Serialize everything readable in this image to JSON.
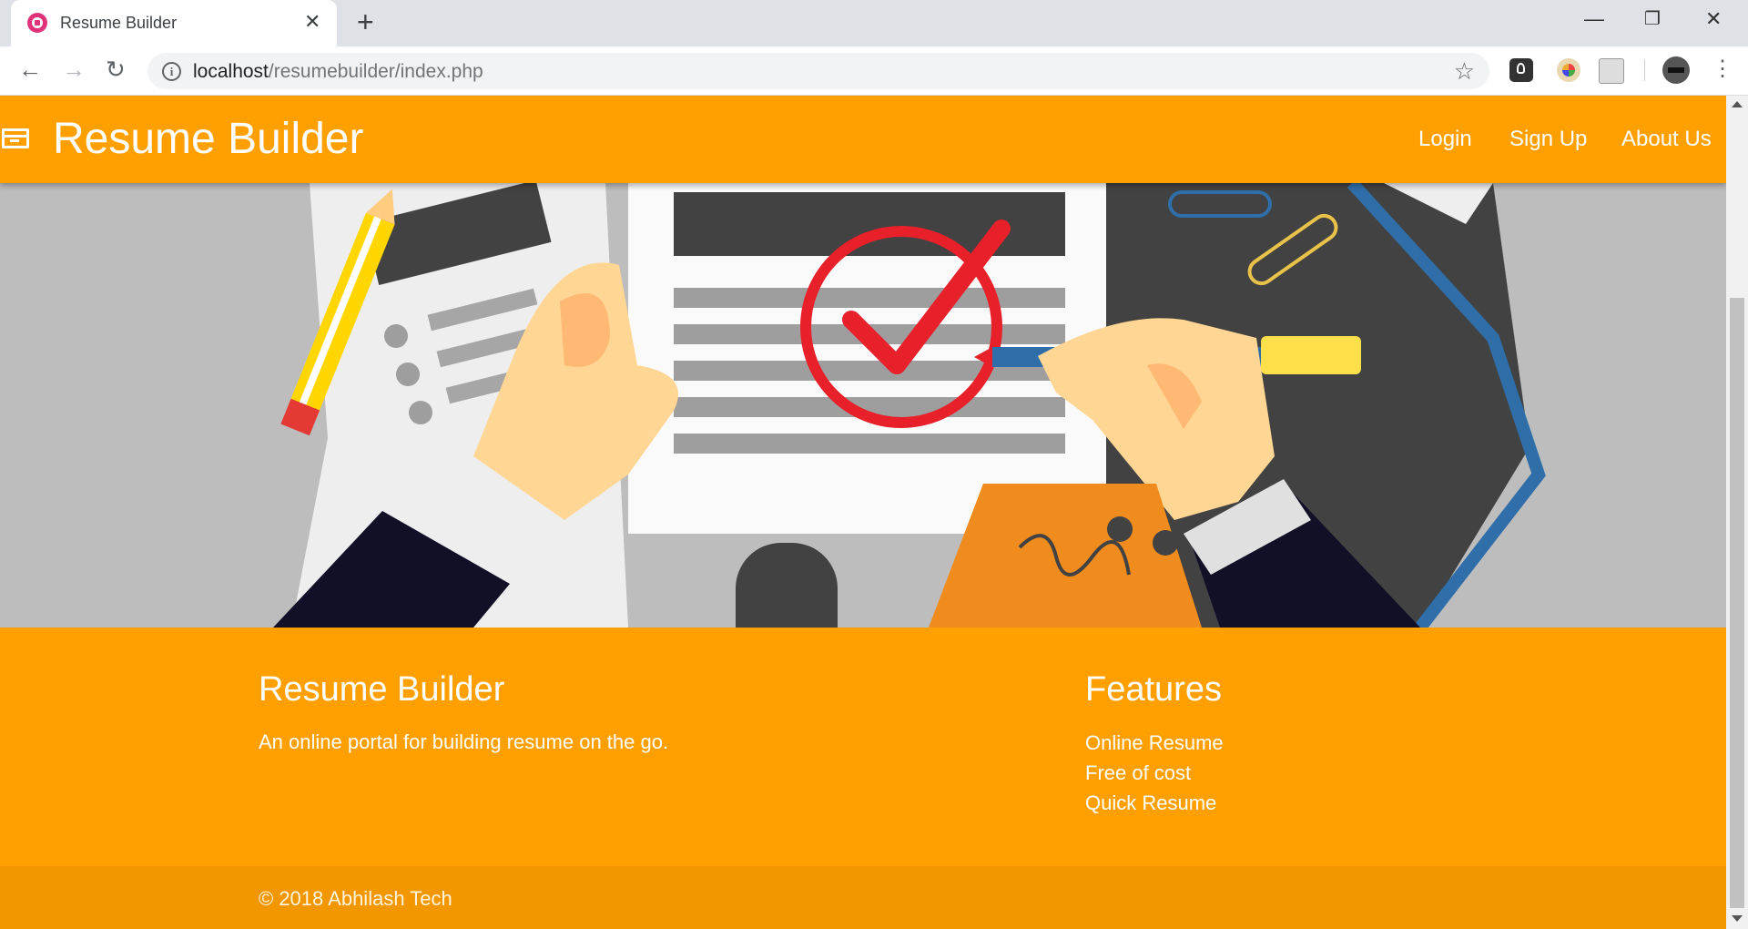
{
  "browser": {
    "tab_title": "Resume Builder",
    "url_host": "localhost",
    "url_path": "/resumebuilder/index.php"
  },
  "navbar": {
    "brand": "Resume Builder",
    "links": [
      "Login",
      "Sign Up",
      "About Us"
    ],
    "color": "#ffa000"
  },
  "footer": {
    "about_title": "Resume Builder",
    "about_text": "An online portal for building resume on the go.",
    "features_title": "Features",
    "features": [
      "Online Resume",
      "Free of cost",
      "Quick Resume"
    ],
    "copyright": "© 2018 Abhilash Tech",
    "copyright_bg": "#f29700"
  }
}
